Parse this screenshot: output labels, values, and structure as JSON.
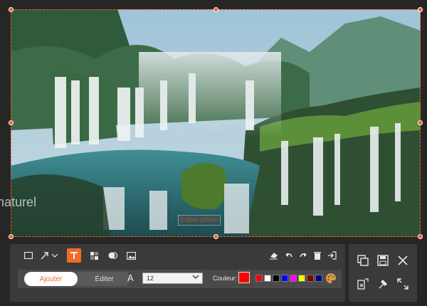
{
  "overlay": {
    "left_text": "naturel",
    "edit_label": "Editer photo"
  },
  "toolbar": {
    "tools": [
      "rectangle-icon",
      "arrow-icon",
      "text-icon",
      "mosaic-icon",
      "blur-icon",
      "image-icon"
    ],
    "actions": [
      "eraser-icon",
      "undo-icon",
      "redo-icon",
      "trash-icon",
      "export-icon"
    ],
    "tabs": {
      "add_label": "Ajouter",
      "edit_label": "Éditer",
      "selected": "Ajouter"
    },
    "font_label": "A",
    "font_size": "12",
    "color_label": "Couleur:",
    "current_color": "#ff0000",
    "swatches": [
      "#ff0000",
      "#ffffff",
      "#000000",
      "#0000ff",
      "#ff00ff",
      "#ffff00",
      "#7a0000",
      "#000080"
    ],
    "palette_icon": "palette-icon"
  },
  "right_panel": {
    "buttons": [
      "copy-icon",
      "save-icon",
      "close-icon",
      "pin-icon",
      "pen-icon",
      "fullscreen-icon"
    ]
  },
  "colors": {
    "accent": "#f26b2a",
    "selection": "#ff5a1f"
  }
}
